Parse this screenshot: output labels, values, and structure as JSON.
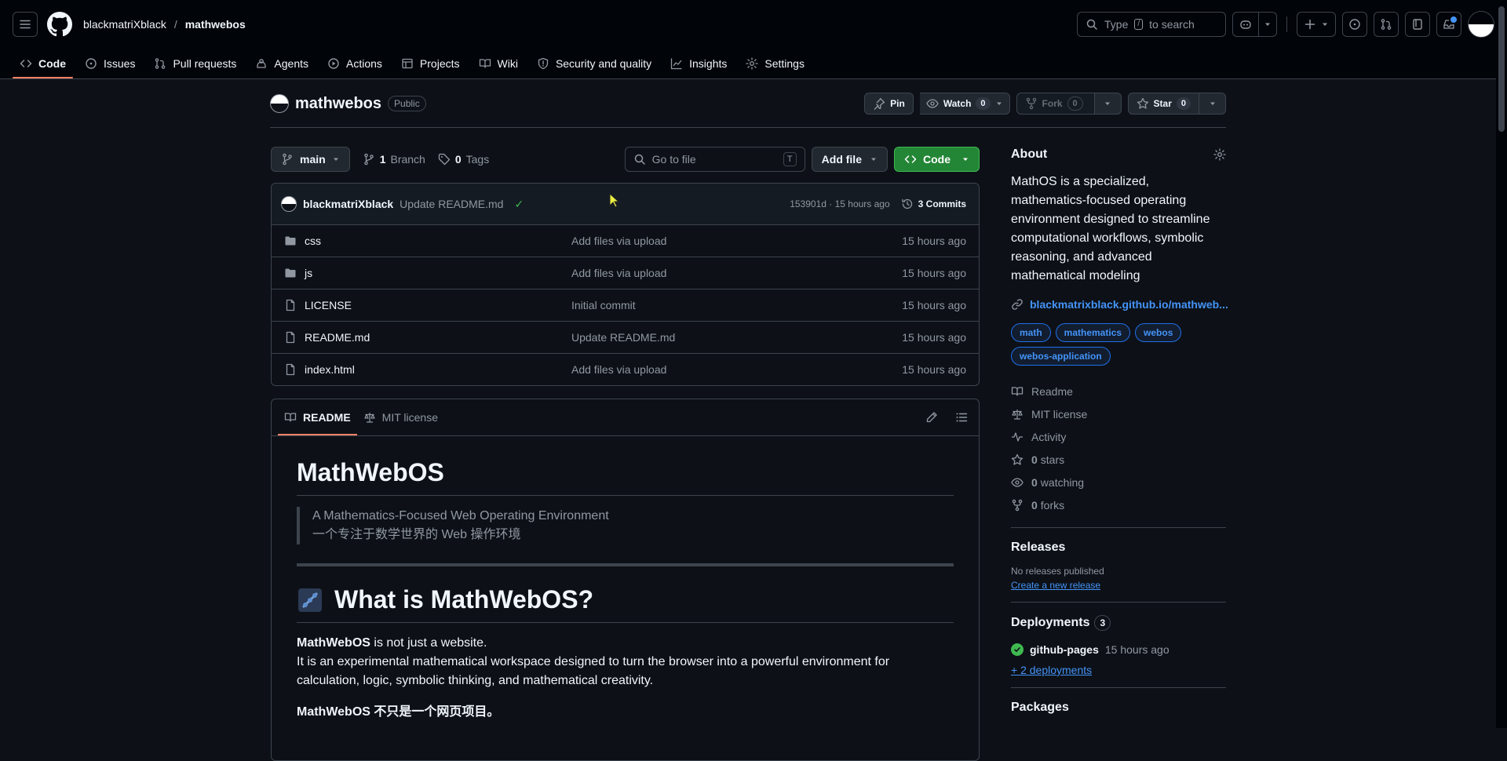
{
  "header": {
    "owner": "blackmatriXblack",
    "separator": "/",
    "repo": "mathwebos",
    "search_prefix": "Type",
    "search_key": "/",
    "search_suffix": "to search"
  },
  "tabs": [
    {
      "label": "Code",
      "icon": "code-icon"
    },
    {
      "label": "Issues",
      "icon": "issue-icon"
    },
    {
      "label": "Pull requests",
      "icon": "pull-request-icon"
    },
    {
      "label": "Agents",
      "icon": "agent-icon"
    },
    {
      "label": "Actions",
      "icon": "play-icon"
    },
    {
      "label": "Projects",
      "icon": "table-icon"
    },
    {
      "label": "Wiki",
      "icon": "book-icon"
    },
    {
      "label": "Security and quality",
      "icon": "shield-icon"
    },
    {
      "label": "Insights",
      "icon": "graph-icon"
    },
    {
      "label": "Settings",
      "icon": "gear-icon"
    }
  ],
  "repo_head": {
    "name": "mathwebos",
    "visibility": "Public",
    "pin_label": "Pin",
    "watch_label": "Watch",
    "watch_count": "0",
    "fork_label": "Fork",
    "fork_count": "0",
    "star_label": "Star",
    "star_count": "0"
  },
  "filebar": {
    "branch": "main",
    "branch_count": "1",
    "branch_label": "Branch",
    "tag_count": "0",
    "tag_label": "Tags",
    "goto_placeholder": "Go to file",
    "goto_key": "T",
    "add_file_label": "Add file",
    "code_label": "Code"
  },
  "commit": {
    "author": "blackmatriXblack",
    "message": "Update README.md",
    "check": "✓",
    "sha_time": "153901d · 15 hours ago",
    "commits_label": "3 Commits"
  },
  "files": [
    {
      "name": "css",
      "type": "folder",
      "message": "Add files via upload",
      "date": "15 hours ago"
    },
    {
      "name": "js",
      "type": "folder",
      "message": "Add files via upload",
      "date": "15 hours ago"
    },
    {
      "name": "LICENSE",
      "type": "file",
      "message": "Initial commit",
      "date": "15 hours ago"
    },
    {
      "name": "README.md",
      "type": "file",
      "message": "Update README.md",
      "date": "15 hours ago"
    },
    {
      "name": "index.html",
      "type": "file",
      "message": "Add files via upload",
      "date": "15 hours ago"
    }
  ],
  "readme": {
    "tab_readme": "README",
    "tab_license": "MIT license",
    "h1": "MathWebOS",
    "quote_line1": "A Mathematics-Focused Web Operating Environment",
    "quote_line2": "一个专注于数学世界的 Web 操作环境",
    "h2": "What is MathWebOS?",
    "p1_bold": "MathWebOS",
    "p1_rest": " is not just a website.",
    "p2": "It is an experimental mathematical workspace designed to turn the browser into a powerful environment for calculation, logic, symbolic thinking, and mathematical creativity.",
    "p3": "MathWebOS 不只是一个网页项目。"
  },
  "about": {
    "title": "About",
    "description": "MathOS is a specialized, mathematics-focused operating environment designed to streamline computational workflows, symbolic reasoning, and advanced mathematical modeling",
    "homepage": "blackmatrixblack.github.io/mathweb...",
    "topics": [
      "math",
      "mathematics",
      "webos",
      "webos-application"
    ],
    "readme": "Readme",
    "license": "MIT license",
    "activity": "Activity",
    "stars_count": "0",
    "stars_label": "stars",
    "watching_count": "0",
    "watching_label": "watching",
    "forks_count": "0",
    "forks_label": "forks"
  },
  "releases": {
    "title": "Releases",
    "none": "No releases published",
    "create": "Create a new release"
  },
  "deployments": {
    "title": "Deployments",
    "count": "3",
    "name": "github-pages",
    "time": "15 hours ago",
    "more": "+ 2 deployments"
  },
  "packages": {
    "title": "Packages"
  },
  "colors": {
    "accent_tab": "#f78166",
    "link": "#4493f8",
    "success": "#3fb950",
    "primary_button": "#238636"
  }
}
